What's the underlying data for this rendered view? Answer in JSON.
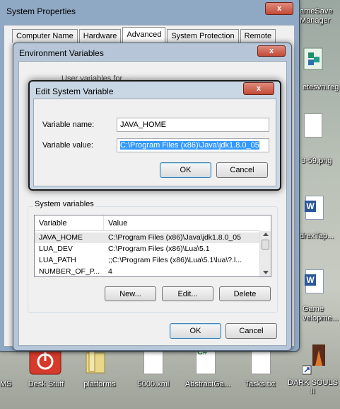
{
  "desktop": {
    "right_icons": [
      {
        "label": "ameSave\nManager"
      },
      {
        "label": "etesvn.reg"
      },
      {
        "label": "3-59.png"
      },
      {
        "label": "drexTap..."
      },
      {
        "label": "Game\nvelopme..."
      }
    ],
    "bottom_icons": [
      {
        "label": "MS"
      },
      {
        "label": "Desk Stuff"
      },
      {
        "label": "platforms"
      },
      {
        "label": "5000.xml"
      },
      {
        "label": "AbstractGa..."
      },
      {
        "label": "Tasks.txt"
      },
      {
        "label": "DARK SOULS\nII"
      }
    ]
  },
  "system_properties": {
    "title": "System Properties",
    "close_label": "x",
    "tabs": [
      "Computer Name",
      "Hardware",
      "Advanced",
      "System Protection",
      "Remote"
    ],
    "active_tab": "Advanced"
  },
  "env_vars": {
    "title": "Environment Variables",
    "close_label": "x",
    "partial_label": "User variables for ...",
    "system_group_label": "System variables",
    "columns": [
      "Variable",
      "Value"
    ],
    "rows": [
      {
        "variable": "JAVA_HOME",
        "value": "C:\\Program Files (x86)\\Java\\jdk1.8.0_05"
      },
      {
        "variable": "LUA_DEV",
        "value": "C:\\Program Files (x86)\\Lua\\5.1"
      },
      {
        "variable": "LUA_PATH",
        "value": ";;C:\\Program Files (x86)\\Lua\\5.1\\lua\\?.l..."
      },
      {
        "variable": "NUMBER_OF_P...",
        "value": "4"
      }
    ],
    "new_label": "New...",
    "edit_label": "Edit...",
    "delete_label": "Delete",
    "ok_label": "OK",
    "cancel_label": "Cancel"
  },
  "edit_dialog": {
    "title": "Edit System Variable",
    "close_label": "x",
    "name_label": "Variable name:",
    "name_value": "JAVA_HOME",
    "value_label": "Variable value:",
    "value_value": "C:\\Program Files (x86)\\Java\\jdk1.8.0_05",
    "ok_label": "OK",
    "cancel_label": "Cancel"
  }
}
